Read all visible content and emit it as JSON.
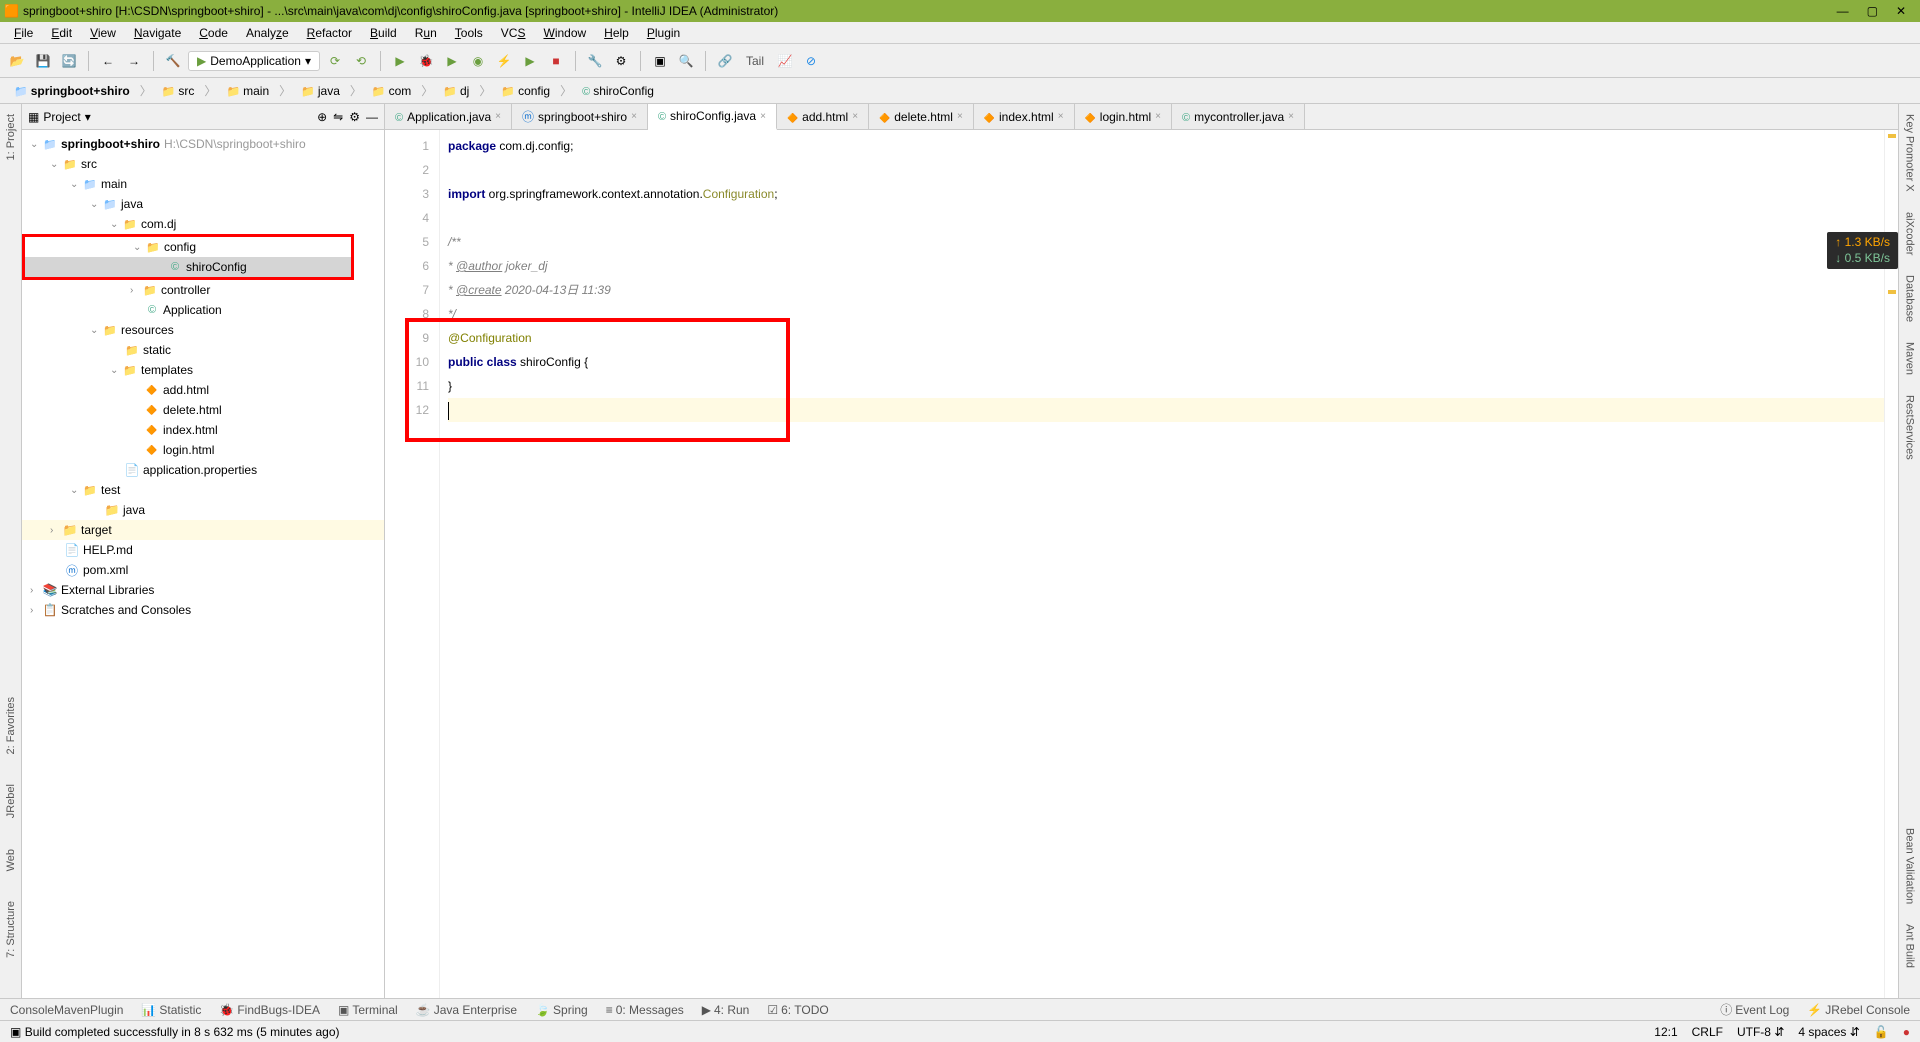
{
  "title": "springboot+shiro [H:\\CSDN\\springboot+shiro] - ...\\src\\main\\java\\com\\dj\\config\\shiroConfig.java [springboot+shiro] - IntelliJ IDEA (Administrator)",
  "menu": [
    "File",
    "Edit",
    "View",
    "Navigate",
    "Code",
    "Analyze",
    "Refactor",
    "Build",
    "Run",
    "Tools",
    "VCS",
    "Window",
    "Help",
    "Plugin"
  ],
  "run_config": "DemoApplication",
  "tail_label": "Tail",
  "breadcrumb": [
    "springboot+shiro",
    "src",
    "main",
    "java",
    "com",
    "dj",
    "config",
    "shiroConfig"
  ],
  "project_header": "Project",
  "tree": {
    "root": "springboot+shiro",
    "root_path": "H:\\CSDN\\springboot+shiro",
    "src": "src",
    "main": "main",
    "java": "java",
    "comdj": "com.dj",
    "config": "config",
    "shiroConfig": "shiroConfig",
    "controller": "controller",
    "application": "Application",
    "resources": "resources",
    "static": "static",
    "templates": "templates",
    "add": "add.html",
    "delete": "delete.html",
    "index": "index.html",
    "login": "login.html",
    "appprops": "application.properties",
    "test": "test",
    "testjava": "java",
    "target": "target",
    "help": "HELP.md",
    "pom": "pom.xml",
    "ext_lib": "External Libraries",
    "scratches": "Scratches and Consoles"
  },
  "tabs": [
    {
      "label": "Application.java",
      "active": false
    },
    {
      "label": "springboot+shiro",
      "active": false
    },
    {
      "label": "shiroConfig.java",
      "active": true
    },
    {
      "label": "add.html",
      "active": false
    },
    {
      "label": "delete.html",
      "active": false
    },
    {
      "label": "index.html",
      "active": false
    },
    {
      "label": "login.html",
      "active": false
    },
    {
      "label": "mycontroller.java",
      "active": false
    }
  ],
  "code": {
    "l1_kw": "package",
    "l1_rest": " com.dj.config;",
    "l3_kw": "import",
    "l3_mid": " org.springframework.context.annotation.",
    "l3_cls": "Configuration",
    "l3_end": ";",
    "l5": "/**",
    "l6_pre": " * ",
    "l6_tag": "@author",
    "l6_rest": " joker_dj",
    "l7_pre": " * ",
    "l7_tag": "@create",
    "l7_rest": " 2020-04-13日 11:39",
    "l8": " */",
    "l9": "@Configuration",
    "l10_kw1": "public",
    "l10_kw2": " class ",
    "l10_name": "shiroConfig",
    "l10_end": " {",
    "l11": "}"
  },
  "net": {
    "up": "↑ 1.3 KB/s",
    "down": "↓ 0.5 KB/s"
  },
  "left_tools": [
    "1: Project",
    "2: Favorites",
    "JRebel",
    "Web",
    "7: Structure"
  ],
  "right_tools": [
    "Key Promoter X",
    "aiXcoder",
    "Database",
    "Maven",
    "RestServices",
    "Bean Validation",
    "Ant Build"
  ],
  "bottom_left": [
    "ConsoleMavenPlugin",
    "Statistic",
    "FindBugs-IDEA",
    "Terminal",
    "Java Enterprise",
    "Spring",
    "0: Messages",
    "4: Run",
    "6: TODO"
  ],
  "bottom_right": [
    "Event Log",
    "JRebel Console"
  ],
  "status_left": "Build completed successfully in 8 s 632 ms (5 minutes ago)",
  "status_right": {
    "pos": "12:1",
    "crlf": "CRLF",
    "enc": "UTF-8",
    "indent": "4 spaces"
  }
}
